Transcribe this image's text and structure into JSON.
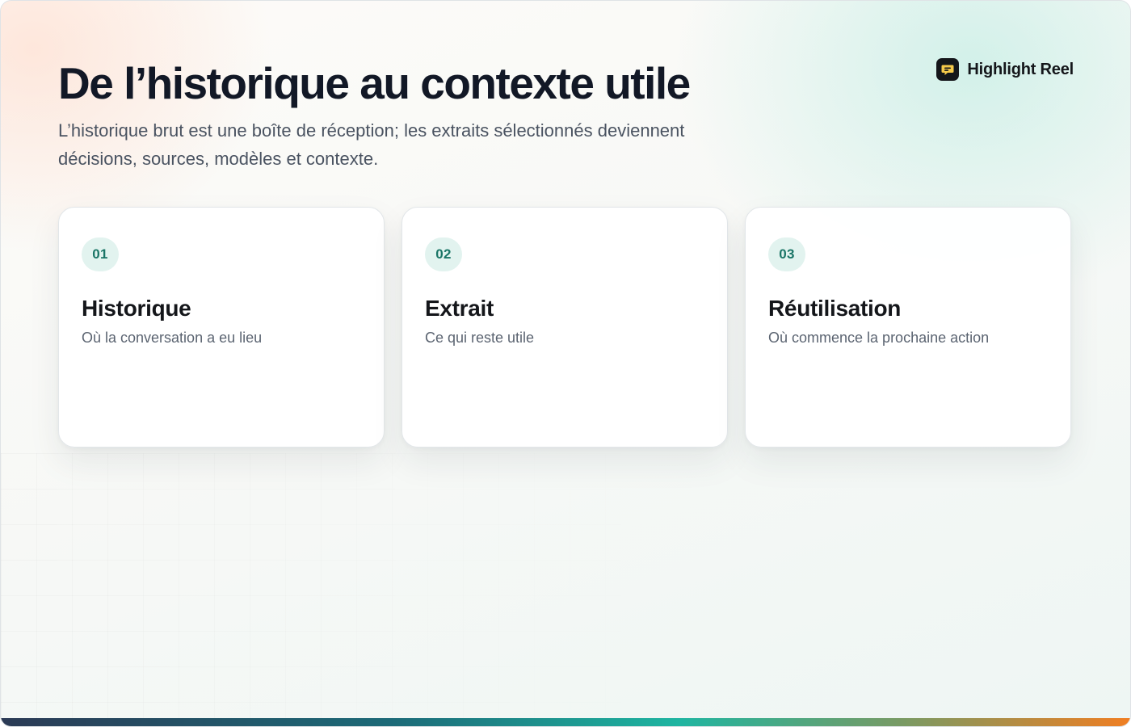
{
  "header": {
    "title": "De l’historique au contexte utile",
    "subtitle": "L’historique brut est une boîte de réception; les extraits sélectionnés deviennent décisions, sources, modèles et contexte."
  },
  "brand": {
    "icon": "chat-bubble-icon",
    "label": "Highlight Reel",
    "icon_accent": "#f5c94a"
  },
  "cards": [
    {
      "number": "01",
      "title": "Historique",
      "description": "Où la conversation a eu lieu"
    },
    {
      "number": "02",
      "title": "Extrait",
      "description": "Ce qui reste utile"
    },
    {
      "number": "03",
      "title": "Réutilisation",
      "description": "Où commence la prochaine action"
    }
  ],
  "colors": {
    "accent": "#1a7566",
    "badge_bg": "#e2f3ef",
    "gradient_start": "#2b3a55",
    "gradient_mid": "#1fb5a1",
    "gradient_end": "#f07e22"
  }
}
